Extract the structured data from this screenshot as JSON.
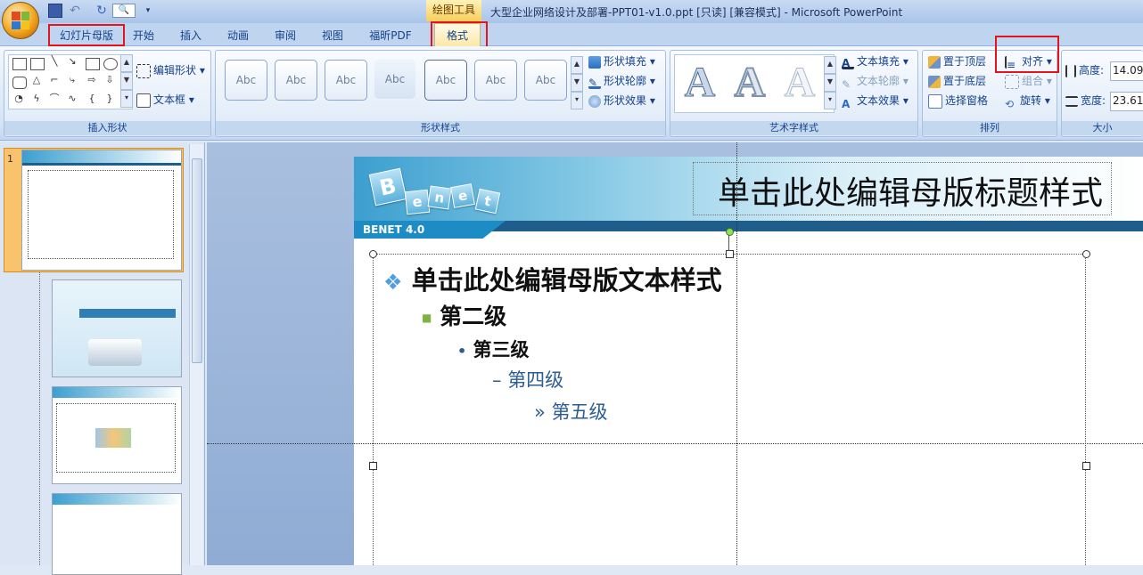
{
  "window": {
    "title": "大型企业网络设计及部署-PPT01-v1.0.ppt [只读] [兼容模式] - Microsoft PowerPoint",
    "context_tools": "绘图工具"
  },
  "tabs": [
    "幻灯片母版",
    "开始",
    "插入",
    "动画",
    "审阅",
    "视图",
    "福昕PDF"
  ],
  "active_tab": "格式",
  "ribbon": {
    "insert_shapes": {
      "label": "插入形状",
      "edit_shape": "编辑形状",
      "text_box": "文本框"
    },
    "shape_styles": {
      "label": "形状样式",
      "swatch_text": "Abc",
      "fill": "形状填充",
      "outline": "形状轮廓",
      "effects": "形状效果"
    },
    "wordart_styles": {
      "label": "艺术字样式",
      "sample": "A",
      "text_fill": "文本填充",
      "text_outline": "文本轮廓",
      "text_effects": "文本效果"
    },
    "arrange": {
      "label": "排列",
      "bring_front": "置于顶层",
      "send_back": "置于底层",
      "selection_pane": "选择窗格",
      "align": "对齐",
      "group": "组合",
      "rotate": "旋转"
    },
    "size": {
      "label": "大小",
      "height_label": "高度:",
      "height_value": "14.09",
      "width_label": "宽度:",
      "width_value": "23.61"
    }
  },
  "thumbnails": {
    "selected_number": "1"
  },
  "slide": {
    "title": "单击此处编辑母版标题样式",
    "badge": "BENET 4.0",
    "logo_letters": [
      "B",
      "e",
      "n",
      "e",
      "t"
    ],
    "levels": [
      {
        "bullet": "❖",
        "text": "单击此处编辑母版文本样式"
      },
      {
        "bullet": "■",
        "text": "第二级"
      },
      {
        "bullet": "•",
        "text": "第三级"
      },
      {
        "bullet": "–",
        "text": "第四级"
      },
      {
        "bullet": "»",
        "text": "第五级"
      }
    ]
  },
  "colors": {
    "highlight_box": "#e3141c",
    "ribbon_text": "#15428b",
    "slide_accent": "#1e8cc4"
  }
}
